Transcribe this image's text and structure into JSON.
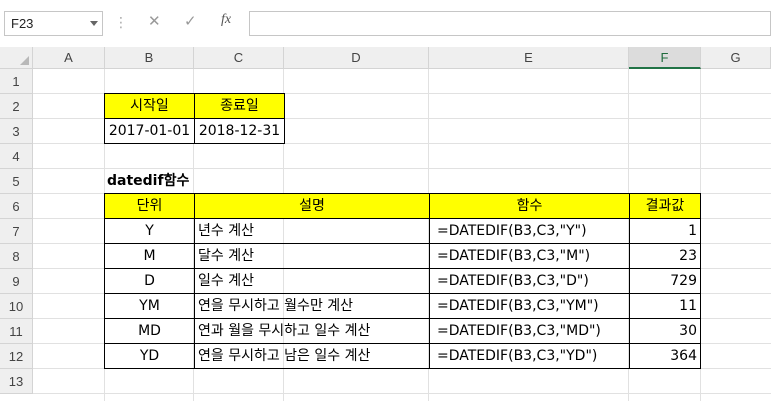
{
  "formula_bar": {
    "name_box": "F23",
    "cancel": "✕",
    "enter": "✓",
    "fx": "fx",
    "formula": ""
  },
  "columns": [
    "A",
    "B",
    "C",
    "D",
    "E",
    "F",
    "G"
  ],
  "rows": [
    "1",
    "2",
    "3",
    "4",
    "5",
    "6",
    "7",
    "8",
    "9",
    "10",
    "11",
    "12",
    "13"
  ],
  "dates": {
    "start_label": "시작일",
    "end_label": "종료일",
    "start_value": "2017-01-01",
    "end_value": "2018-12-31"
  },
  "section_title": "datedif함수",
  "table": {
    "headers": [
      "단위",
      "설명",
      "함수",
      "결과값"
    ],
    "rows": [
      [
        "Y",
        "년수 계산",
        "=DATEDIF(B3,C3,\"Y\")",
        "1"
      ],
      [
        "M",
        "달수 계산",
        "=DATEDIF(B3,C3,\"M\")",
        "23"
      ],
      [
        "D",
        "일수 계산",
        "=DATEDIF(B3,C3,\"D\")",
        "729"
      ],
      [
        "YM",
        "연을 무시하고 월수만 계산",
        "=DATEDIF(B3,C3,\"YM\")",
        "11"
      ],
      [
        "MD",
        "연과 월을 무시하고 일수 계산",
        "=DATEDIF(B3,C3,\"MD\")",
        "30"
      ],
      [
        "YD",
        "연을 무시하고 남은 일수 계산",
        "=DATEDIF(B3,C3,\"YD\")",
        "364"
      ]
    ]
  },
  "colors": {
    "highlight": "#ffff00",
    "selected_col": "#217346"
  }
}
